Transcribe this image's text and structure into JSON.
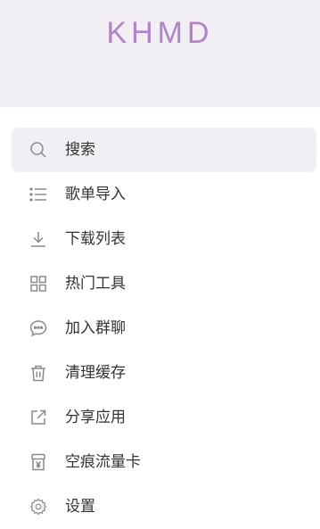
{
  "app": {
    "brand": "KHMD"
  },
  "menu": {
    "items": [
      {
        "label": "搜索",
        "icon": "search-icon"
      },
      {
        "label": "歌单导入",
        "icon": "list-icon"
      },
      {
        "label": "下载列表",
        "icon": "download-icon"
      },
      {
        "label": "热门工具",
        "icon": "grid-icon"
      },
      {
        "label": "加入群聊",
        "icon": "chat-icon"
      },
      {
        "label": "清理缓存",
        "icon": "trash-icon"
      },
      {
        "label": "分享应用",
        "icon": "share-icon"
      },
      {
        "label": "空痕流量卡",
        "icon": "sim-card-icon"
      },
      {
        "label": "设置",
        "icon": "gear-icon"
      }
    ]
  },
  "colors": {
    "header_bg": "#f2eff4",
    "brand": "#b183c8",
    "icon": "#8a8a8a",
    "text": "#333333"
  }
}
